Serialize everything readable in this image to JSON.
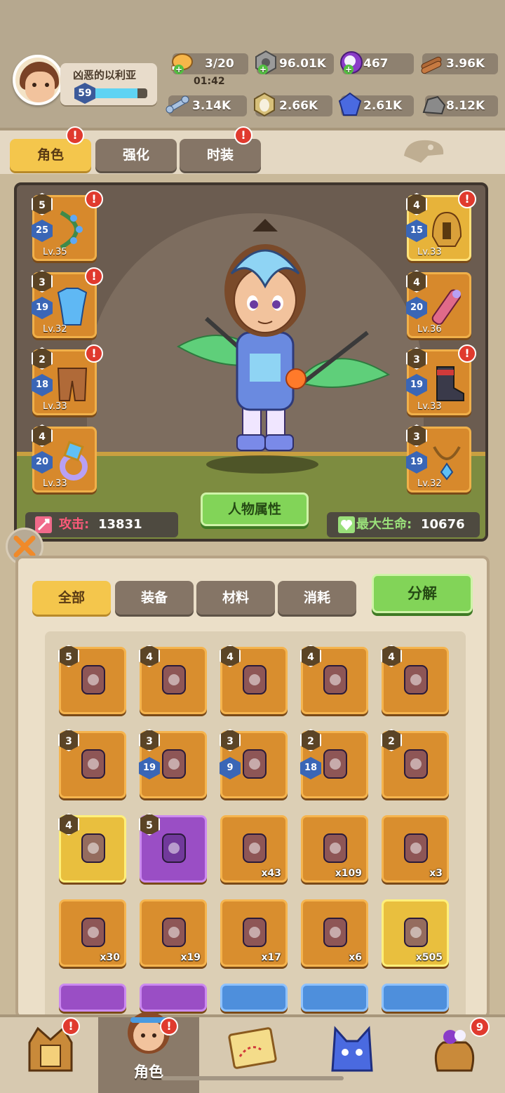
{
  "player": {
    "name": "凶恶的以利亚",
    "level": "59",
    "xp_fraction": 0.82
  },
  "resources": {
    "stamina": {
      "value": "3/20",
      "timer": "01:42",
      "icon": "meat-icon"
    },
    "gear_coins": {
      "value": "96.01K",
      "icon": "nut-coin-icon"
    },
    "gems": {
      "value": "467",
      "icon": "purple-pearl-icon"
    },
    "wood": {
      "value": "3.96K",
      "icon": "log-icon"
    },
    "bone": {
      "value": "3.14K",
      "icon": "bone-icon"
    },
    "egg": {
      "value": "2.66K",
      "icon": "egg-icon"
    },
    "crystal": {
      "value": "2.61K",
      "icon": "blue-crystal-icon"
    },
    "ore": {
      "value": "8.12K",
      "icon": "iron-ore-icon"
    }
  },
  "tabs": [
    {
      "label": "角色",
      "active": true,
      "badge": "!"
    },
    {
      "label": "强化",
      "active": false,
      "badge": ""
    },
    {
      "label": "时装",
      "active": false,
      "badge": "!"
    }
  ],
  "equipment": {
    "left": [
      {
        "stars": "5",
        "enhance": "25",
        "level": "Lv.35",
        "badge": "!",
        "icon": "bow-icon"
      },
      {
        "stars": "3",
        "enhance": "19",
        "level": "Lv.32",
        "badge": "!",
        "icon": "armor-icon"
      },
      {
        "stars": "2",
        "enhance": "18",
        "level": "Lv.33",
        "badge": "!",
        "icon": "pants-icon"
      },
      {
        "stars": "4",
        "enhance": "20",
        "level": "Lv.33",
        "badge": "",
        "icon": "ring-icon"
      }
    ],
    "right": [
      {
        "stars": "4",
        "enhance": "15",
        "level": "Lv.33",
        "badge": "!",
        "icon": "helmet-icon"
      },
      {
        "stars": "4",
        "enhance": "20",
        "level": "Lv.36",
        "badge": "",
        "icon": "arrow-quiver-icon"
      },
      {
        "stars": "3",
        "enhance": "19",
        "level": "Lv.33",
        "badge": "!",
        "icon": "boots-icon"
      },
      {
        "stars": "3",
        "enhance": "19",
        "level": "Lv.32",
        "badge": "",
        "icon": "necklace-icon"
      }
    ]
  },
  "stats": {
    "attack_label": "攻击:",
    "attack_value": "13831",
    "hp_label": "最大生命:",
    "hp_value": "10676",
    "attributes_button": "人物属性"
  },
  "inventory": {
    "filters": [
      {
        "label": "全部",
        "active": true
      },
      {
        "label": "装备",
        "active": false
      },
      {
        "label": "材料",
        "active": false
      },
      {
        "label": "消耗",
        "active": false
      }
    ],
    "decompose_label": "分解",
    "items": [
      {
        "stars": "5",
        "enhance": "",
        "count": "",
        "color": "orange",
        "icon": "dark-bow-icon"
      },
      {
        "stars": "4",
        "enhance": "",
        "count": "",
        "color": "orange",
        "icon": "vine-bow-icon"
      },
      {
        "stars": "4",
        "enhance": "",
        "count": "",
        "color": "orange",
        "icon": "purple-helmet-icon"
      },
      {
        "stars": "4",
        "enhance": "",
        "count": "",
        "color": "orange",
        "icon": "purple-armor-icon"
      },
      {
        "stars": "4",
        "enhance": "",
        "count": "",
        "color": "orange",
        "icon": "purple-boots-icon"
      },
      {
        "stars": "3",
        "enhance": "",
        "count": "",
        "color": "orange",
        "icon": "pink-boots-icon"
      },
      {
        "stars": "3",
        "enhance": "19",
        "count": "",
        "color": "orange",
        "icon": "spear-icon"
      },
      {
        "stars": "3",
        "enhance": "9",
        "count": "",
        "color": "orange",
        "icon": "blue-bow-icon"
      },
      {
        "stars": "2",
        "enhance": "18",
        "count": "",
        "color": "orange",
        "icon": "scroll-arrow-icon"
      },
      {
        "stars": "2",
        "enhance": "",
        "count": "",
        "color": "orange",
        "icon": "scroll-arrow-icon"
      },
      {
        "stars": "4",
        "enhance": "",
        "count": "",
        "color": "gold",
        "icon": "lightning-helmet-icon"
      },
      {
        "stars": "5",
        "enhance": "",
        "count": "",
        "color": "purple",
        "icon": "star-necklace-icon"
      },
      {
        "stars": "",
        "enhance": "",
        "count": "x43",
        "color": "orange",
        "icon": "key-icon"
      },
      {
        "stars": "",
        "enhance": "",
        "count": "x109",
        "color": "orange",
        "icon": "potion-bottle-icon"
      },
      {
        "stars": "",
        "enhance": "",
        "count": "x3",
        "color": "orange",
        "icon": "hammer-icon"
      },
      {
        "stars": "",
        "enhance": "",
        "count": "x30",
        "color": "orange",
        "icon": "blue-shard-icon"
      },
      {
        "stars": "",
        "enhance": "",
        "count": "x19",
        "color": "orange",
        "icon": "rune-stone-icon"
      },
      {
        "stars": "",
        "enhance": "",
        "count": "x17",
        "color": "orange",
        "icon": "red-crystal-icon"
      },
      {
        "stars": "",
        "enhance": "",
        "count": "x6",
        "color": "orange",
        "icon": "shield-emblem-icon"
      },
      {
        "stars": "",
        "enhance": "",
        "count": "x505",
        "color": "gold",
        "icon": "gold-pile-icon"
      }
    ]
  },
  "bottom_nav": [
    {
      "label": "",
      "icon": "castle-gate-icon",
      "badge": "!",
      "active": false
    },
    {
      "label": "角色",
      "icon": "hero-face-icon",
      "badge": "!",
      "active": true
    },
    {
      "label": "",
      "icon": "treasure-map-icon",
      "badge": "",
      "active": false
    },
    {
      "label": "",
      "icon": "blue-wolf-icon",
      "badge": "",
      "active": false
    },
    {
      "label": "",
      "icon": "loot-bag-icon",
      "badge": "9",
      "active": false
    }
  ]
}
